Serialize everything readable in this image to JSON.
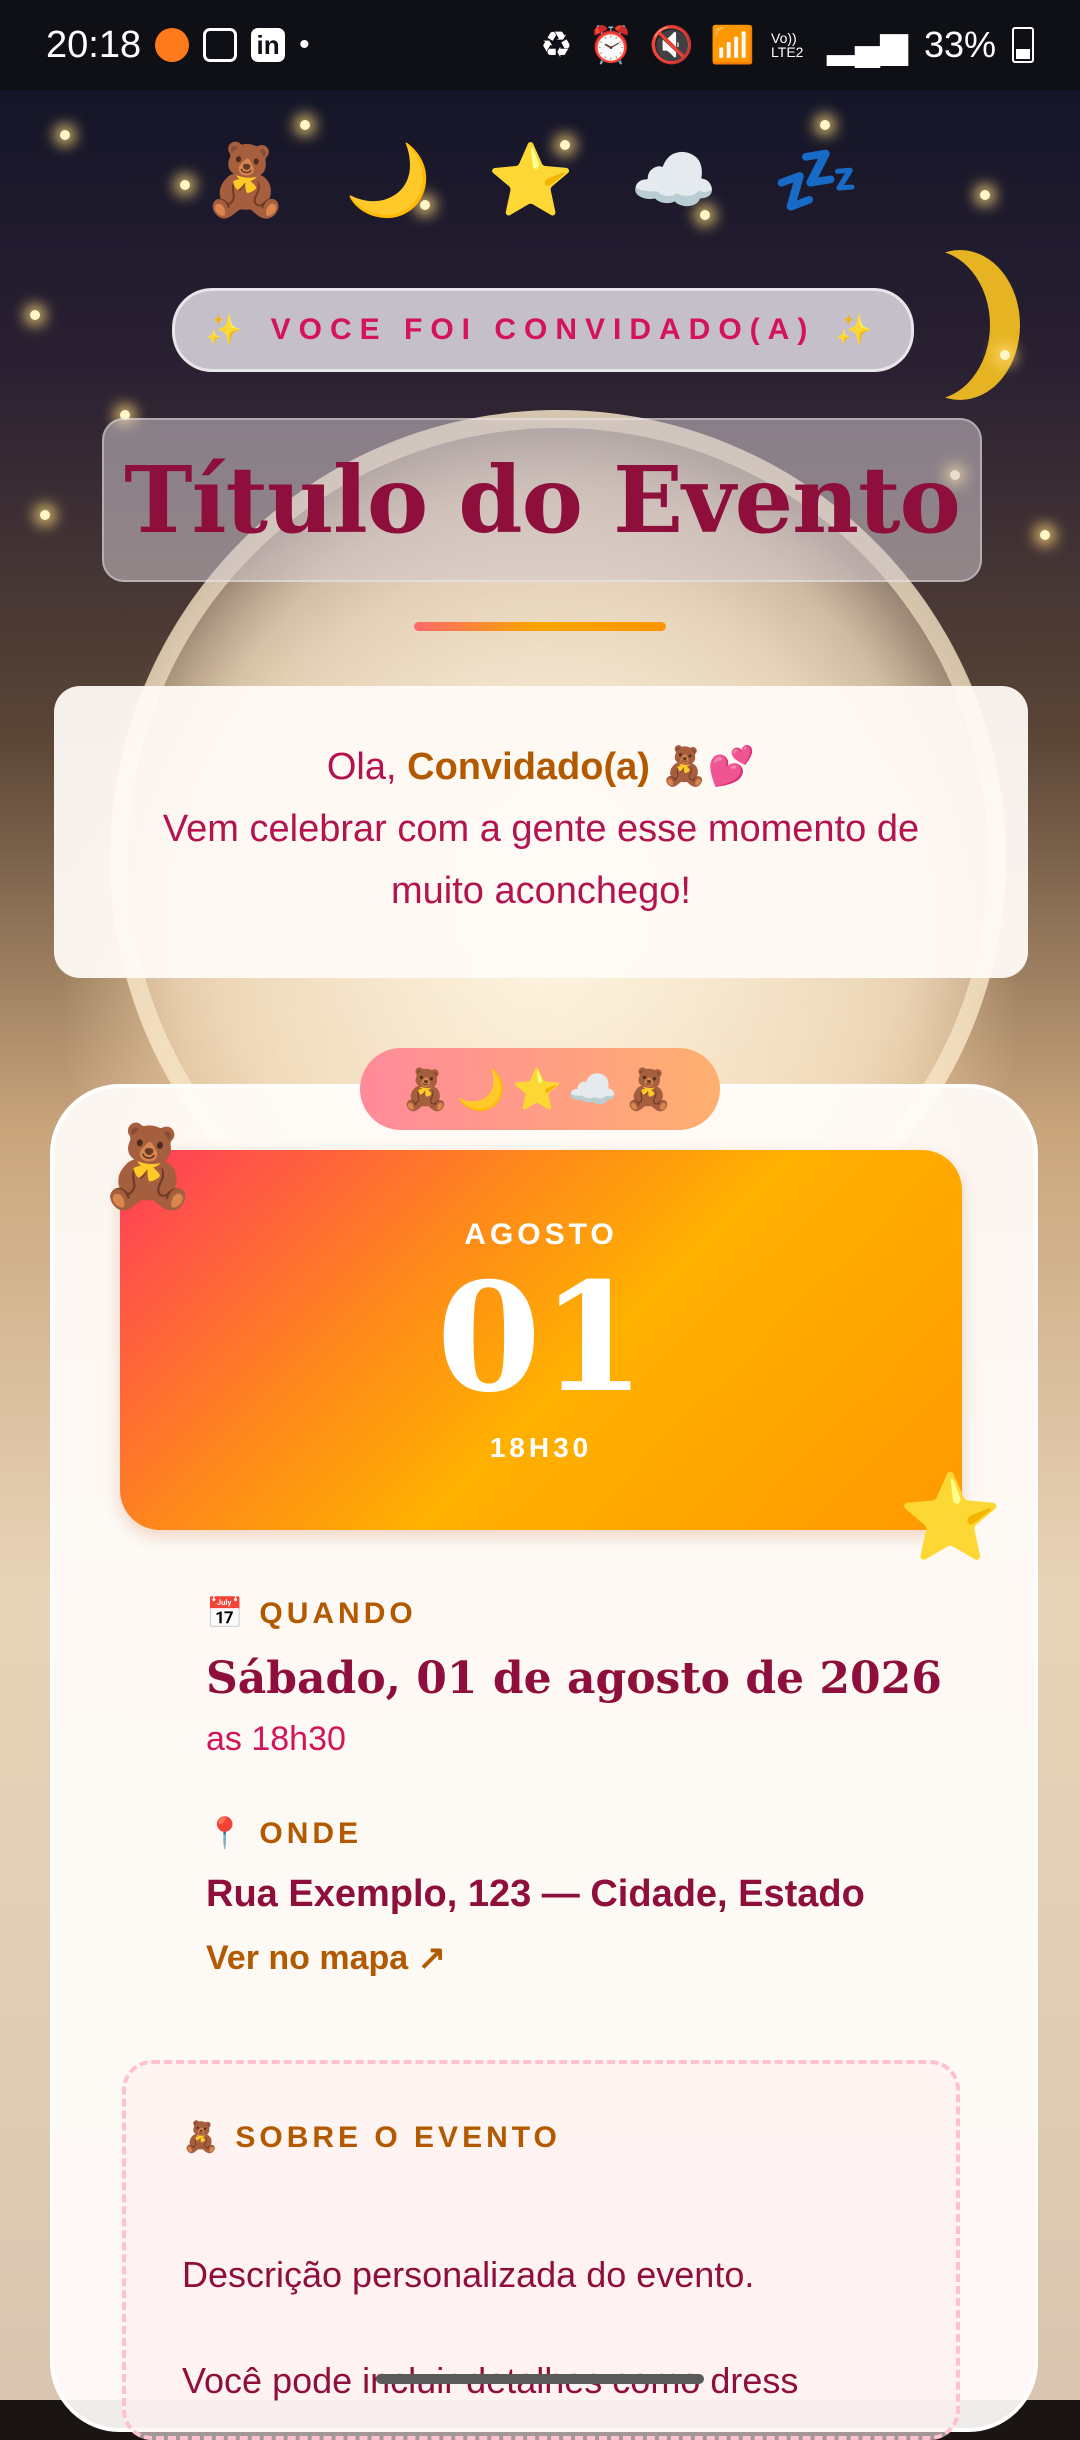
{
  "status_bar": {
    "time": "20:18",
    "battery": "33%",
    "icons": [
      "orange-app-icon",
      "gallery-icon",
      "linkedin-icon",
      "dot-icon",
      "battery-saver-icon",
      "alarm-icon",
      "mute-icon",
      "wifi-icon",
      "signal-icon",
      "volte-icon",
      "signal-icon"
    ],
    "volte": "Vo)) LTE2"
  },
  "header": {
    "emojis": "🧸 🌙 ⭐ ☁️ 💤",
    "invite_left_emoji": "✨",
    "invite_text": "VOCE FOI CONVIDADO(A)",
    "invite_right_emoji": "✨",
    "title": "Título do Evento"
  },
  "greeting": {
    "prefix": "Ola,",
    "name": "Convidado(a)",
    "emojis": "🧸💕",
    "message": "Vem celebrar com a gente esse momento de muito aconchego!"
  },
  "card": {
    "badge_emojis": "🧸🌙⭐☁️🧸",
    "corner_bear": "🧸",
    "corner_star": "⭐",
    "date": {
      "month": "AGOSTO",
      "day": "01",
      "time": "18H30"
    },
    "when": {
      "icon": "📅",
      "label": "QUANDO",
      "main": "Sábado, 01 de agosto de 2026",
      "sub": "as 18h30"
    },
    "where": {
      "icon": "📍",
      "label": "ONDE",
      "main": "Rua Exemplo, 123 — Cidade, Estado",
      "map_link": "Ver no mapa ↗"
    },
    "about": {
      "icon": "🧸",
      "label": "SOBRE O EVENTO",
      "text": "Descrição personalizada do evento.",
      "more": "Você pode incluir detalhes como dress"
    }
  },
  "colors": {
    "accent": "#8e0f3c",
    "pink": "#d4145a",
    "orange": "#b35a00",
    "gradient_start": "#ff3b5c",
    "gradient_end": "#ff9a00"
  }
}
